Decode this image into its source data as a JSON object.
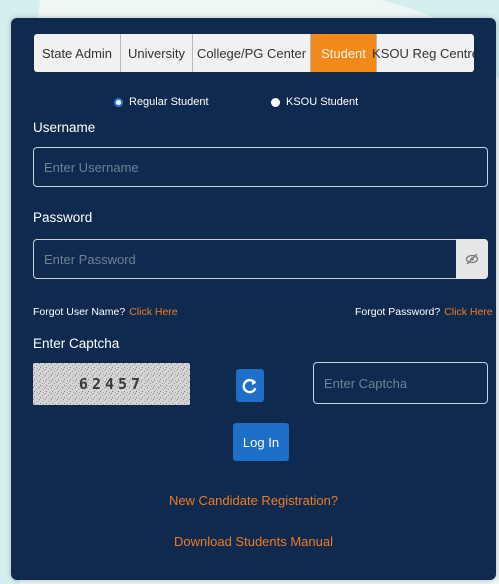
{
  "tabs": [
    {
      "label": "State Admin",
      "active": false
    },
    {
      "label": "University",
      "active": false
    },
    {
      "label": "College/PG Center",
      "active": false
    },
    {
      "label": "Student",
      "active": true
    },
    {
      "label": "KSOU Reg Centre",
      "active": false
    }
  ],
  "student_type": {
    "options": [
      {
        "label": "Regular Student",
        "selected": true
      },
      {
        "label": "KSOU Student",
        "selected": false
      }
    ]
  },
  "username": {
    "label": "Username",
    "placeholder": "Enter Username",
    "value": ""
  },
  "password": {
    "label": "Password",
    "placeholder": "Enter Password",
    "value": "",
    "toggle_icon": "eye-slash-icon"
  },
  "forgot_username": {
    "text": "Forgot User Name?",
    "link": "Click Here"
  },
  "forgot_password": {
    "text": "Forgot Password?",
    "link": "Click Here"
  },
  "captcha": {
    "label": "Enter Captcha",
    "code": "62457",
    "placeholder": "Enter Captcha",
    "value": "",
    "refresh_icon": "refresh-icon"
  },
  "login_button": "Log In",
  "links": {
    "new_registration": "New Candidate Registration?",
    "download_manual": "Download Students Manual"
  },
  "colors": {
    "panel_bg": "#0f2a4e",
    "accent_orange": "#f28a1b",
    "link_orange": "#f07b22",
    "button_blue": "#1e6fc8"
  }
}
